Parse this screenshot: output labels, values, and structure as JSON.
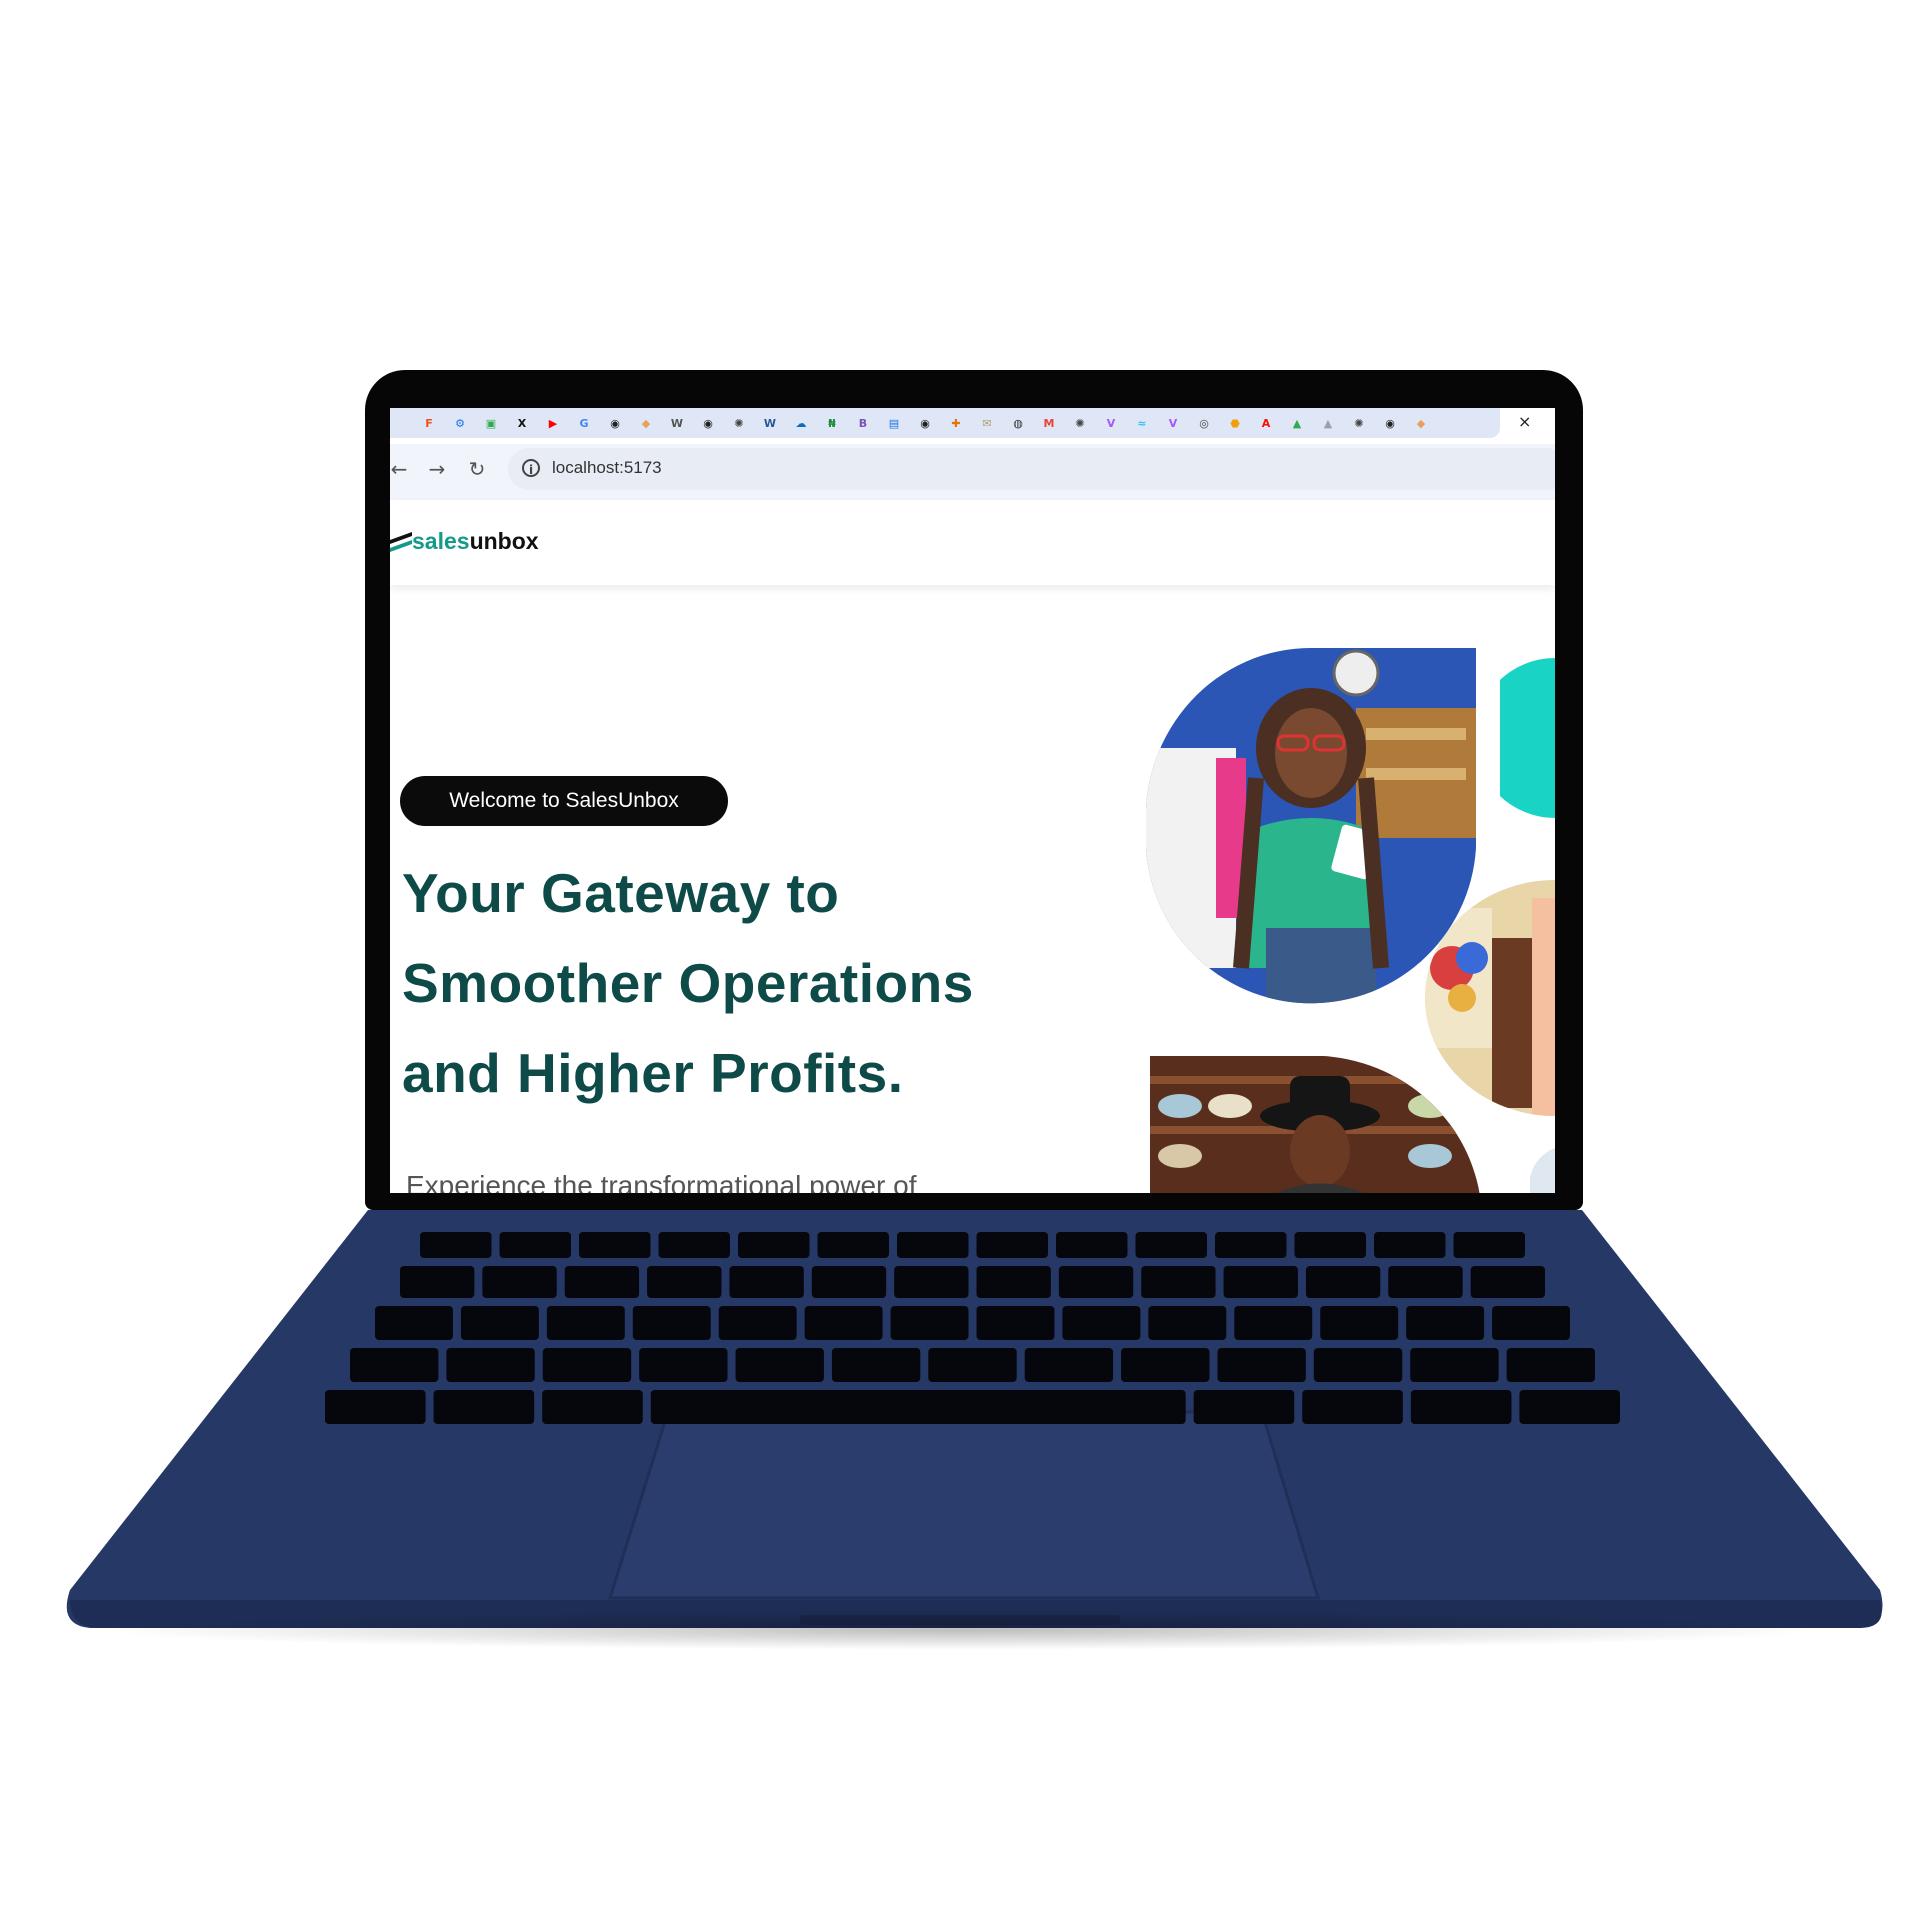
{
  "browser": {
    "bookmarks": [
      {
        "name": "figma",
        "glyph": "F",
        "color": "#f24e1e"
      },
      {
        "name": "settings",
        "glyph": "⚙",
        "color": "#1a73e8"
      },
      {
        "name": "meet",
        "glyph": "▣",
        "color": "#34a853"
      },
      {
        "name": "x",
        "glyph": "X",
        "color": "#111111"
      },
      {
        "name": "youtube",
        "glyph": "▶",
        "color": "#ff0000"
      },
      {
        "name": "google",
        "glyph": "G",
        "color": "#4285f4"
      },
      {
        "name": "github",
        "glyph": "◉",
        "color": "#222222"
      },
      {
        "name": "bookmark",
        "glyph": "◆",
        "color": "#e8a05a"
      },
      {
        "name": "wikipedia",
        "glyph": "W",
        "color": "#555555"
      },
      {
        "name": "github",
        "glyph": "◉",
        "color": "#222222"
      },
      {
        "name": "openai",
        "glyph": "✺",
        "color": "#444444"
      },
      {
        "name": "word",
        "glyph": "W",
        "color": "#2b579a"
      },
      {
        "name": "onedrive",
        "glyph": "☁",
        "color": "#0f6cbd"
      },
      {
        "name": "naira",
        "glyph": "₦",
        "color": "#1e8e3e"
      },
      {
        "name": "bootstrap",
        "glyph": "B",
        "color": "#7952b3"
      },
      {
        "name": "docs",
        "glyph": "▤",
        "color": "#1a73e8"
      },
      {
        "name": "github",
        "glyph": "◉",
        "color": "#222222"
      },
      {
        "name": "puzzle",
        "glyph": "✚",
        "color": "#e37400"
      },
      {
        "name": "mail",
        "glyph": "✉",
        "color": "#b0a070"
      },
      {
        "name": "globe",
        "glyph": "◍",
        "color": "#333333"
      },
      {
        "name": "gmail",
        "glyph": "M",
        "color": "#ea4335"
      },
      {
        "name": "openai",
        "glyph": "✺",
        "color": "#444444"
      },
      {
        "name": "vue",
        "glyph": "V",
        "color": "#a855f7"
      },
      {
        "name": "tailwind",
        "glyph": "≈",
        "color": "#38bdf8"
      },
      {
        "name": "vite",
        "glyph": "V",
        "color": "#a855f7"
      },
      {
        "name": "chrome",
        "glyph": "◎",
        "color": "#444444"
      },
      {
        "name": "badge",
        "glyph": "⬣",
        "color": "#f59e0b"
      },
      {
        "name": "adobe",
        "glyph": "A",
        "color": "#fa0f00"
      },
      {
        "name": "drive",
        "glyph": "▲",
        "color": "#34a853"
      },
      {
        "name": "drive",
        "glyph": "▲",
        "color": "#9aa0a6"
      },
      {
        "name": "openai",
        "glyph": "✺",
        "color": "#444444"
      },
      {
        "name": "github",
        "glyph": "◉",
        "color": "#222222"
      },
      {
        "name": "bookmark",
        "glyph": "◆",
        "color": "#e8a05a"
      }
    ],
    "close_glyph": "×",
    "back_glyph": "←",
    "forward_glyph": "→",
    "reload_glyph": "↻",
    "info_glyph": "i",
    "url": "localhost:5173"
  },
  "site": {
    "logo_part1": "sales",
    "logo_part2": "unbox",
    "welcome_pill": "Welcome to SalesUnbox",
    "headline_lines": [
      "Your Gateway to",
      "Smoother Operations",
      "and Higher Profits."
    ],
    "subtext": "Experience the transformational power of"
  },
  "colors": {
    "brand_teal": "#149a8b",
    "headline_green": "#0e4a48",
    "laptop_navy": "#263866",
    "accent_cyan": "#19d3c5"
  }
}
